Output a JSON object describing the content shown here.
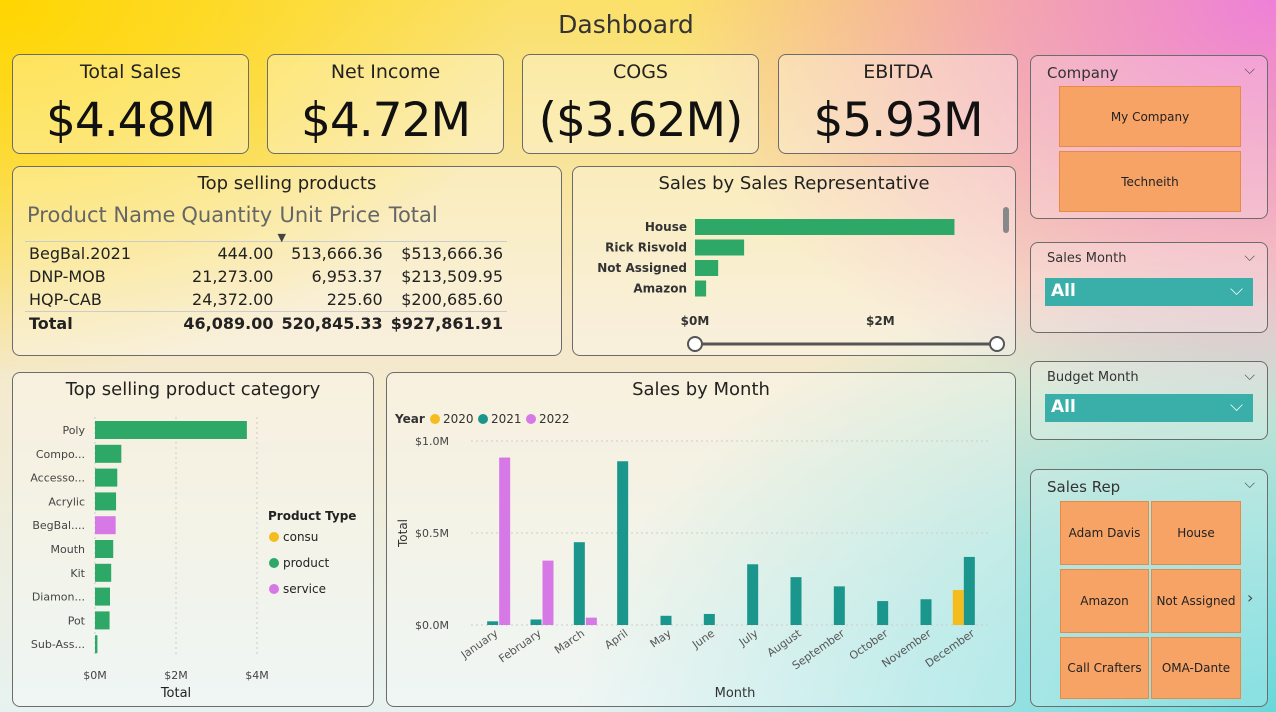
{
  "page_title": "Dashboard",
  "kpis": [
    {
      "label": "Total Sales",
      "value": "$4.48M"
    },
    {
      "label": "Net Income",
      "value": "$4.72M"
    },
    {
      "label": "COGS",
      "value": "($3.62M)"
    },
    {
      "label": "EBITDA",
      "value": "$5.93M"
    }
  ],
  "top_products": {
    "title": "Top selling products",
    "columns": [
      "Product Name",
      "Quantity",
      "Unit Price",
      "Total"
    ],
    "rows": [
      [
        "BegBal.2021",
        "444.00",
        "513,666.36",
        "$513,666.36"
      ],
      [
        "DNP-MOB",
        "21,273.00",
        "6,953.37",
        "$213,509.95"
      ],
      [
        "HQP-CAB",
        "24,372.00",
        "225.60",
        "$200,685.60"
      ]
    ],
    "total": [
      "Total",
      "46,089.00",
      "520,845.33",
      "$927,861.91"
    ],
    "sort_icon": "sort-down-icon"
  },
  "colors": {
    "green": "#2ea866",
    "purple": "#d678e6",
    "teal": "#1a968c",
    "orange": "#f7a366",
    "gold": "#f4bc1c",
    "dropdown": "#3aafa9"
  },
  "chart_data": [
    {
      "id": "sales_rep",
      "type": "bar",
      "orientation": "horizontal",
      "title": "Sales by Sales Representative",
      "categories": [
        "House",
        "Rick Risvold",
        "Not Assigned",
        "Amazon"
      ],
      "values": [
        2.8,
        0.53,
        0.25,
        0.12
      ],
      "tick_labels": [
        "$0M",
        "$2M"
      ],
      "xlim": [
        0,
        3.0
      ],
      "color": "#2ea866"
    },
    {
      "id": "product_category",
      "type": "bar",
      "orientation": "horizontal",
      "title": "Top selling product category",
      "xlabel": "Total",
      "categories": [
        "Poly",
        "Compo...",
        "Accesso...",
        "Acrylic",
        "BegBal....",
        "Mouth",
        "Kit",
        "Diamon...",
        "Pot",
        "Sub-Ass..."
      ],
      "values": [
        3.75,
        0.65,
        0.55,
        0.52,
        0.51,
        0.45,
        0.4,
        0.37,
        0.36,
        0.06
      ],
      "types": [
        "product",
        "product",
        "product",
        "product",
        "service",
        "product",
        "product",
        "product",
        "product",
        "product"
      ],
      "tick_labels": [
        "$0M",
        "$2M",
        "$4M"
      ],
      "xlim": [
        0,
        4.0
      ],
      "legend_title": "Product Type",
      "legend": [
        {
          "name": "consu",
          "color": "#f4bc1c"
        },
        {
          "name": "product",
          "color": "#2ea866"
        },
        {
          "name": "service",
          "color": "#d678e6"
        }
      ]
    },
    {
      "id": "sales_by_month",
      "type": "bar",
      "title": "Sales by Month",
      "xlabel": "Month",
      "ylabel": "Total",
      "legend_title": "Year",
      "categories": [
        "January",
        "February",
        "March",
        "April",
        "May",
        "June",
        "July",
        "August",
        "September",
        "October",
        "November",
        "December"
      ],
      "ylim": [
        0,
        1.0
      ],
      "tick_labels": [
        "$0.0M",
        "$0.5M",
        "$1.0M"
      ],
      "series": [
        {
          "name": "2020",
          "color": "#f4bc1c",
          "values": [
            0,
            0,
            0,
            0,
            0,
            0,
            0,
            0,
            0,
            0,
            0,
            0.19
          ]
        },
        {
          "name": "2021",
          "color": "#1a968c",
          "values": [
            0.02,
            0.03,
            0.45,
            0.89,
            0.05,
            0.06,
            0.33,
            0.26,
            0.21,
            0.13,
            0.14,
            0.37
          ]
        },
        {
          "name": "2022",
          "color": "#d678e6",
          "values": [
            0.91,
            0.35,
            0.04,
            0,
            0,
            0,
            0,
            0,
            0,
            0,
            0,
            0
          ]
        }
      ]
    }
  ],
  "slicers": {
    "company": {
      "title": "Company",
      "items": [
        "My Company",
        "Techneith"
      ]
    },
    "sales_month": {
      "title": "Sales Month",
      "value": "All"
    },
    "budget_month": {
      "title": "Budget Month",
      "value": "All"
    },
    "sales_rep": {
      "title": "Sales Rep",
      "items": [
        "Adam Davis",
        "House",
        "Amazon",
        "Not Assigned",
        "Call Crafters",
        "OMA-Dante"
      ]
    }
  },
  "icons": {
    "chevron": "chevron-down-icon",
    "next": "chevron-right-icon"
  }
}
